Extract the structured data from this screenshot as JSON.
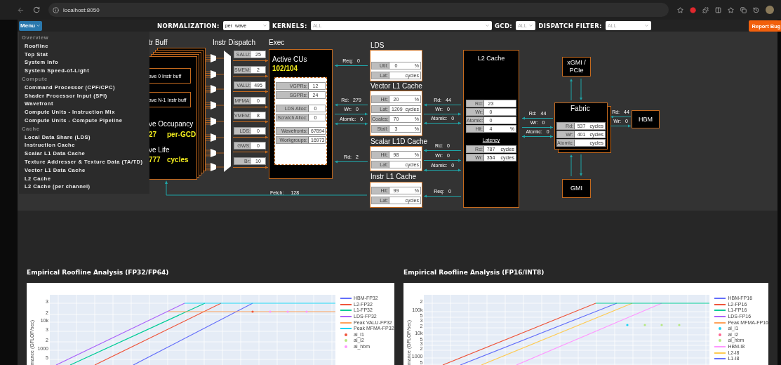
{
  "browser": {
    "url": "localhost:8050"
  },
  "toolbar": {
    "menu_button": "Menu",
    "filters": [
      {
        "label": "NORMALIZATION:",
        "value": "per_wave"
      },
      {
        "label": "KERNELS:",
        "placeholder": "ALL"
      },
      {
        "label": "GCD:",
        "placeholder": "ALL"
      },
      {
        "label": "DISPATCH FILTER:",
        "placeholder": "ALL"
      }
    ],
    "report_button": "Report Bug"
  },
  "menu": {
    "sections": [
      {
        "header": "Overview",
        "items": [
          "Roofline",
          "Top Stat",
          "System Info",
          "System Speed-of-Light"
        ]
      },
      {
        "header": "Compute",
        "items": [
          "Command Processor (CPF/CPC)",
          "Shader Processor Input (SPI)",
          "Wavefront",
          "Compute Units - Instruction Mix",
          "Compute Units - Compute Pipeline"
        ]
      },
      {
        "header": "Cache",
        "items": [
          "Local Data Share (LDS)",
          "Instruction Cache",
          "Scalar L1 Data Cache",
          "Texture Addresser & Texture Data (TA/TD)",
          "Vector L1 Data Cache",
          "L2 Cache",
          "L2 Cache (per channel)"
        ]
      }
    ]
  },
  "diagram": {
    "instr_buff": {
      "title": "tr Buff",
      "buffers": [
        "ave 0 Instr buff",
        "ave N-1 Instr buff"
      ],
      "occupancy": {
        "label": "ve Occupancy",
        "value": "27",
        "unit": "per-GCD"
      },
      "life": {
        "label": "ve Life",
        "value": "777",
        "unit": "cycles"
      }
    },
    "dispatch": {
      "title": "Instr Dispatch",
      "units": [
        {
          "name": "SALU:",
          "value": "25"
        },
        {
          "name": "SMEM:",
          "value": "2"
        },
        {
          "name": "VALU:",
          "value": "495"
        },
        {
          "name": "MFMA:",
          "value": "0"
        },
        {
          "name": "VMEM:",
          "value": "8"
        },
        {
          "name": "LDS:",
          "value": "0"
        },
        {
          "name": "GWS:",
          "value": "0"
        },
        {
          "name": "Br:",
          "value": "10"
        }
      ]
    },
    "exec": {
      "title": "Exec",
      "active_label": "Active CUs",
      "active_value": "102/104",
      "stat_groups": [
        [
          {
            "name": "VGPRs:",
            "value": "12"
          },
          {
            "name": "SGPRs:",
            "value": "24"
          }
        ],
        [
          {
            "name": "LDS Alloc:",
            "value": "0"
          },
          {
            "name": "Scratch Alloc:",
            "value": "0"
          }
        ],
        [
          {
            "name": "Wavefronts:",
            "value": "67894"
          },
          {
            "name": "Workgroups:",
            "value": "16973"
          }
        ]
      ]
    },
    "caches": [
      {
        "title": "LDS",
        "rows": [
          {
            "name": "Util:",
            "value": "0",
            "unit": "%"
          },
          {
            "name": "Lat:",
            "unit": "cycles"
          }
        ]
      },
      {
        "title": "Vector L1 Cache",
        "rows": [
          {
            "name": "Hit:",
            "value": "20",
            "unit": "%"
          },
          {
            "name": "Lat:",
            "value": "1209",
            "unit": "cycles"
          },
          {
            "name": "Coales:",
            "value": "70",
            "unit": "%"
          },
          {
            "name": "Stall:",
            "value": "3",
            "unit": "%"
          }
        ]
      },
      {
        "title": "Scalar L1D Cache",
        "rows": [
          {
            "name": "Hit:",
            "value": "98",
            "unit": "%"
          },
          {
            "name": "Lat:",
            "unit": "cycles"
          }
        ]
      },
      {
        "title": "Instr L1 Cache",
        "rows": [
          {
            "name": "Hit:",
            "value": "99",
            "unit": "%"
          },
          {
            "name": "Lat:",
            "unit": "cycles"
          }
        ]
      }
    ],
    "l2": {
      "title": "L2 Cache",
      "rows": [
        {
          "name": "Rd:",
          "value": "23"
        },
        {
          "name": "Wr:",
          "value": "0"
        },
        {
          "name": "Atomic:",
          "value": "0"
        },
        {
          "name": "Hit:",
          "value": "4",
          "unit": "%"
        }
      ],
      "latency_label": "Latency",
      "latency_rows": [
        {
          "name": "Rd:",
          "value": "787",
          "unit": "cycles"
        },
        {
          "name": "Wr:",
          "value": "354",
          "unit": "cycles"
        }
      ]
    },
    "fabric": {
      "title": "Fabric",
      "rows": [
        {
          "name": "Rd:",
          "value": "537",
          "unit": "cycles"
        },
        {
          "name": "Wr:",
          "value": "401",
          "unit": "cycles"
        },
        {
          "name": "Atomic:",
          "unit": "cycles"
        }
      ]
    },
    "xgmi": "xGMI / PCIe",
    "gmi": "GMI",
    "hbm": "HBM",
    "fetch": {
      "label": "Fetch:",
      "value": "128"
    },
    "link_groups": [
      [
        {
          "label": "Req:",
          "value": "0"
        },
        {
          "label": "Rd:",
          "value": "279"
        },
        {
          "label": "Wr:",
          "value": "0"
        },
        {
          "label": "Atomic:",
          "value": "0"
        },
        {
          "label": "Rd:",
          "value": "2"
        }
      ],
      [
        {
          "label": "Rd:",
          "value": "44"
        },
        {
          "label": "Wr:",
          "value": "0"
        },
        {
          "label": "Atomic:",
          "value": "0"
        },
        {
          "label": "Rd:",
          "value": "0"
        },
        {
          "label": "Wr:",
          "value": "0"
        },
        {
          "label": "Atomic:",
          "value": "0"
        },
        {
          "label": "Req:",
          "value": "0"
        }
      ],
      [
        {
          "label": "Rd:",
          "value": "44"
        },
        {
          "label": "Wr:",
          "value": "0"
        },
        {
          "label": "Atomic:",
          "value": "0"
        }
      ],
      [
        {
          "label": "Rd:",
          "value": "44"
        },
        {
          "label": "Wr:",
          "value": "0"
        }
      ]
    ]
  },
  "charts": [
    {
      "title": "Empirical Roofline Analysis (FP32/FP64)",
      "ylabel": "mance (GFLOP/sec)",
      "y_tick_labels": [
        "3",
        "2",
        "10k",
        "3",
        "2",
        "1000",
        "5"
      ],
      "legend": [
        {
          "name": "HBM-FP32",
          "color": "#636efa",
          "kind": "line"
        },
        {
          "name": "L2-FP32",
          "color": "#ef553b",
          "kind": "line"
        },
        {
          "name": "L1-FP32",
          "color": "#00cc96",
          "kind": "line"
        },
        {
          "name": "LDS-FP32",
          "color": "#ab63fa",
          "kind": "line"
        },
        {
          "name": "Peak VALU-FP32",
          "color": "#ffa15a",
          "kind": "line"
        },
        {
          "name": "Peak MFMA-FP32",
          "color": "#19d3f3",
          "kind": "line"
        },
        {
          "name": "al_l1",
          "color": "#ef553b",
          "kind": "marker"
        },
        {
          "name": "al_l2",
          "color": "#b6e880",
          "kind": "marker"
        },
        {
          "name": "al_hbm",
          "color": "#ff97ff",
          "kind": "marker"
        }
      ]
    },
    {
      "title": "Empirical Roofline Analysis (FP16/INT8)",
      "ylabel": "mance (GFLOP/sec)",
      "y_tick_labels": [
        "2",
        "100k",
        "5",
        "3",
        "2",
        "10k",
        "5",
        "3",
        "2",
        "1000",
        "5"
      ],
      "legend": [
        {
          "name": "HBM-FP16",
          "color": "#636efa",
          "kind": "line"
        },
        {
          "name": "L2-FP16",
          "color": "#ef553b",
          "kind": "line"
        },
        {
          "name": "L1-FP16",
          "color": "#00cc96",
          "kind": "line"
        },
        {
          "name": "LDS-FP16",
          "color": "#ab63fa",
          "kind": "line"
        },
        {
          "name": "Peak MFMA-FP16",
          "color": "#ffa15a",
          "kind": "line"
        },
        {
          "name": "al_l1",
          "color": "#19d3f3",
          "kind": "marker"
        },
        {
          "name": "al_l2",
          "color": "#ff6692",
          "kind": "marker"
        },
        {
          "name": "al_hbm",
          "color": "#b6e880",
          "kind": "marker"
        },
        {
          "name": "HBM-I8",
          "color": "#ff97ff",
          "kind": "line"
        },
        {
          "name": "L2-I8",
          "color": "#fecb52",
          "kind": "line"
        },
        {
          "name": "L1-I8",
          "color": "#636efa",
          "kind": "line"
        }
      ]
    }
  ]
}
